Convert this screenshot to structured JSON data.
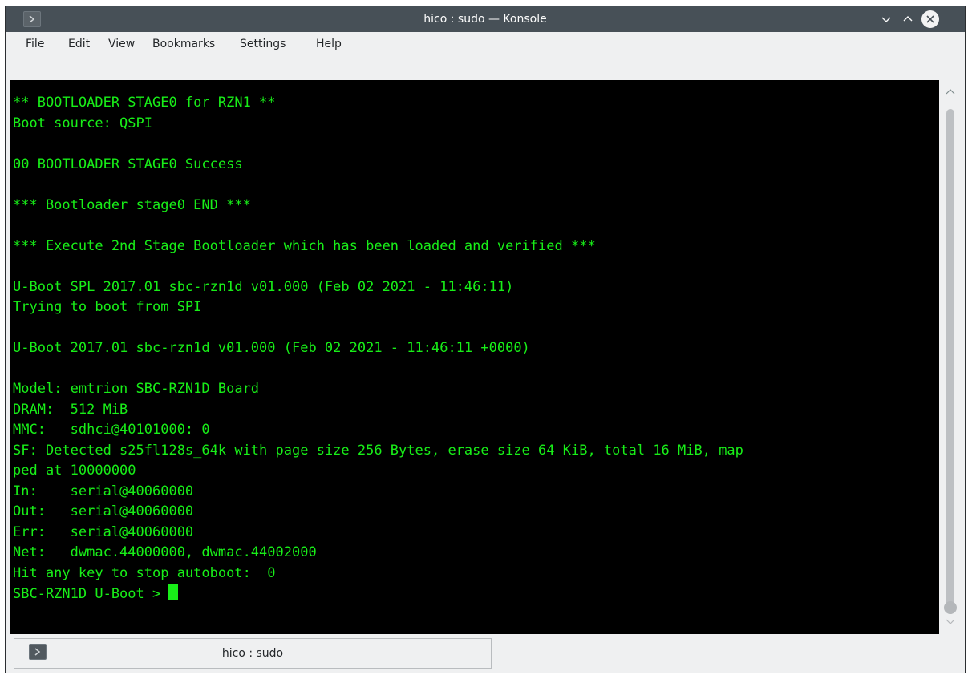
{
  "window": {
    "title": "hico : sudo — Konsole"
  },
  "menu": {
    "items": [
      "File",
      "Edit",
      "View",
      "Bookmarks",
      "Settings",
      "Help"
    ]
  },
  "terminal": {
    "lines": [
      "** BOOTLOADER STAGE0 for RZN1 **",
      "Boot source: QSPI",
      "",
      "00 BOOTLOADER STAGE0 Success",
      "",
      "*** Bootloader stage0 END ***",
      "",
      "*** Execute 2nd Stage Bootloader which has been loaded and verified ***",
      "",
      "U-Boot SPL 2017.01 sbc-rzn1d v01.000 (Feb 02 2021 - 11:46:11)",
      "Trying to boot from SPI",
      "",
      "U-Boot 2017.01 sbc-rzn1d v01.000 (Feb 02 2021 - 11:46:11 +0000)",
      "",
      "Model: emtrion SBC-RZN1D Board",
      "DRAM:  512 MiB",
      "MMC:   sdhci@40101000: 0",
      "SF: Detected s25fl128s_64k with page size 256 Bytes, erase size 64 KiB, total 16 MiB, map",
      "ped at 10000000",
      "In:    serial@40060000",
      "Out:   serial@40060000",
      "Err:   serial@40060000",
      "Net:   dwmac.44000000, dwmac.44002000",
      "Hit any key to stop autoboot:  0"
    ],
    "prompt": "SBC-RZN1D U-Boot > ",
    "text_color": "#18ee18",
    "background_color": "#000000"
  },
  "tabs": [
    {
      "label": "hico : sudo"
    }
  ],
  "icons": {
    "app": "terminal-icon",
    "minimize": "chevron-down-icon",
    "maximize": "chevron-up-icon",
    "close": "close-icon"
  }
}
